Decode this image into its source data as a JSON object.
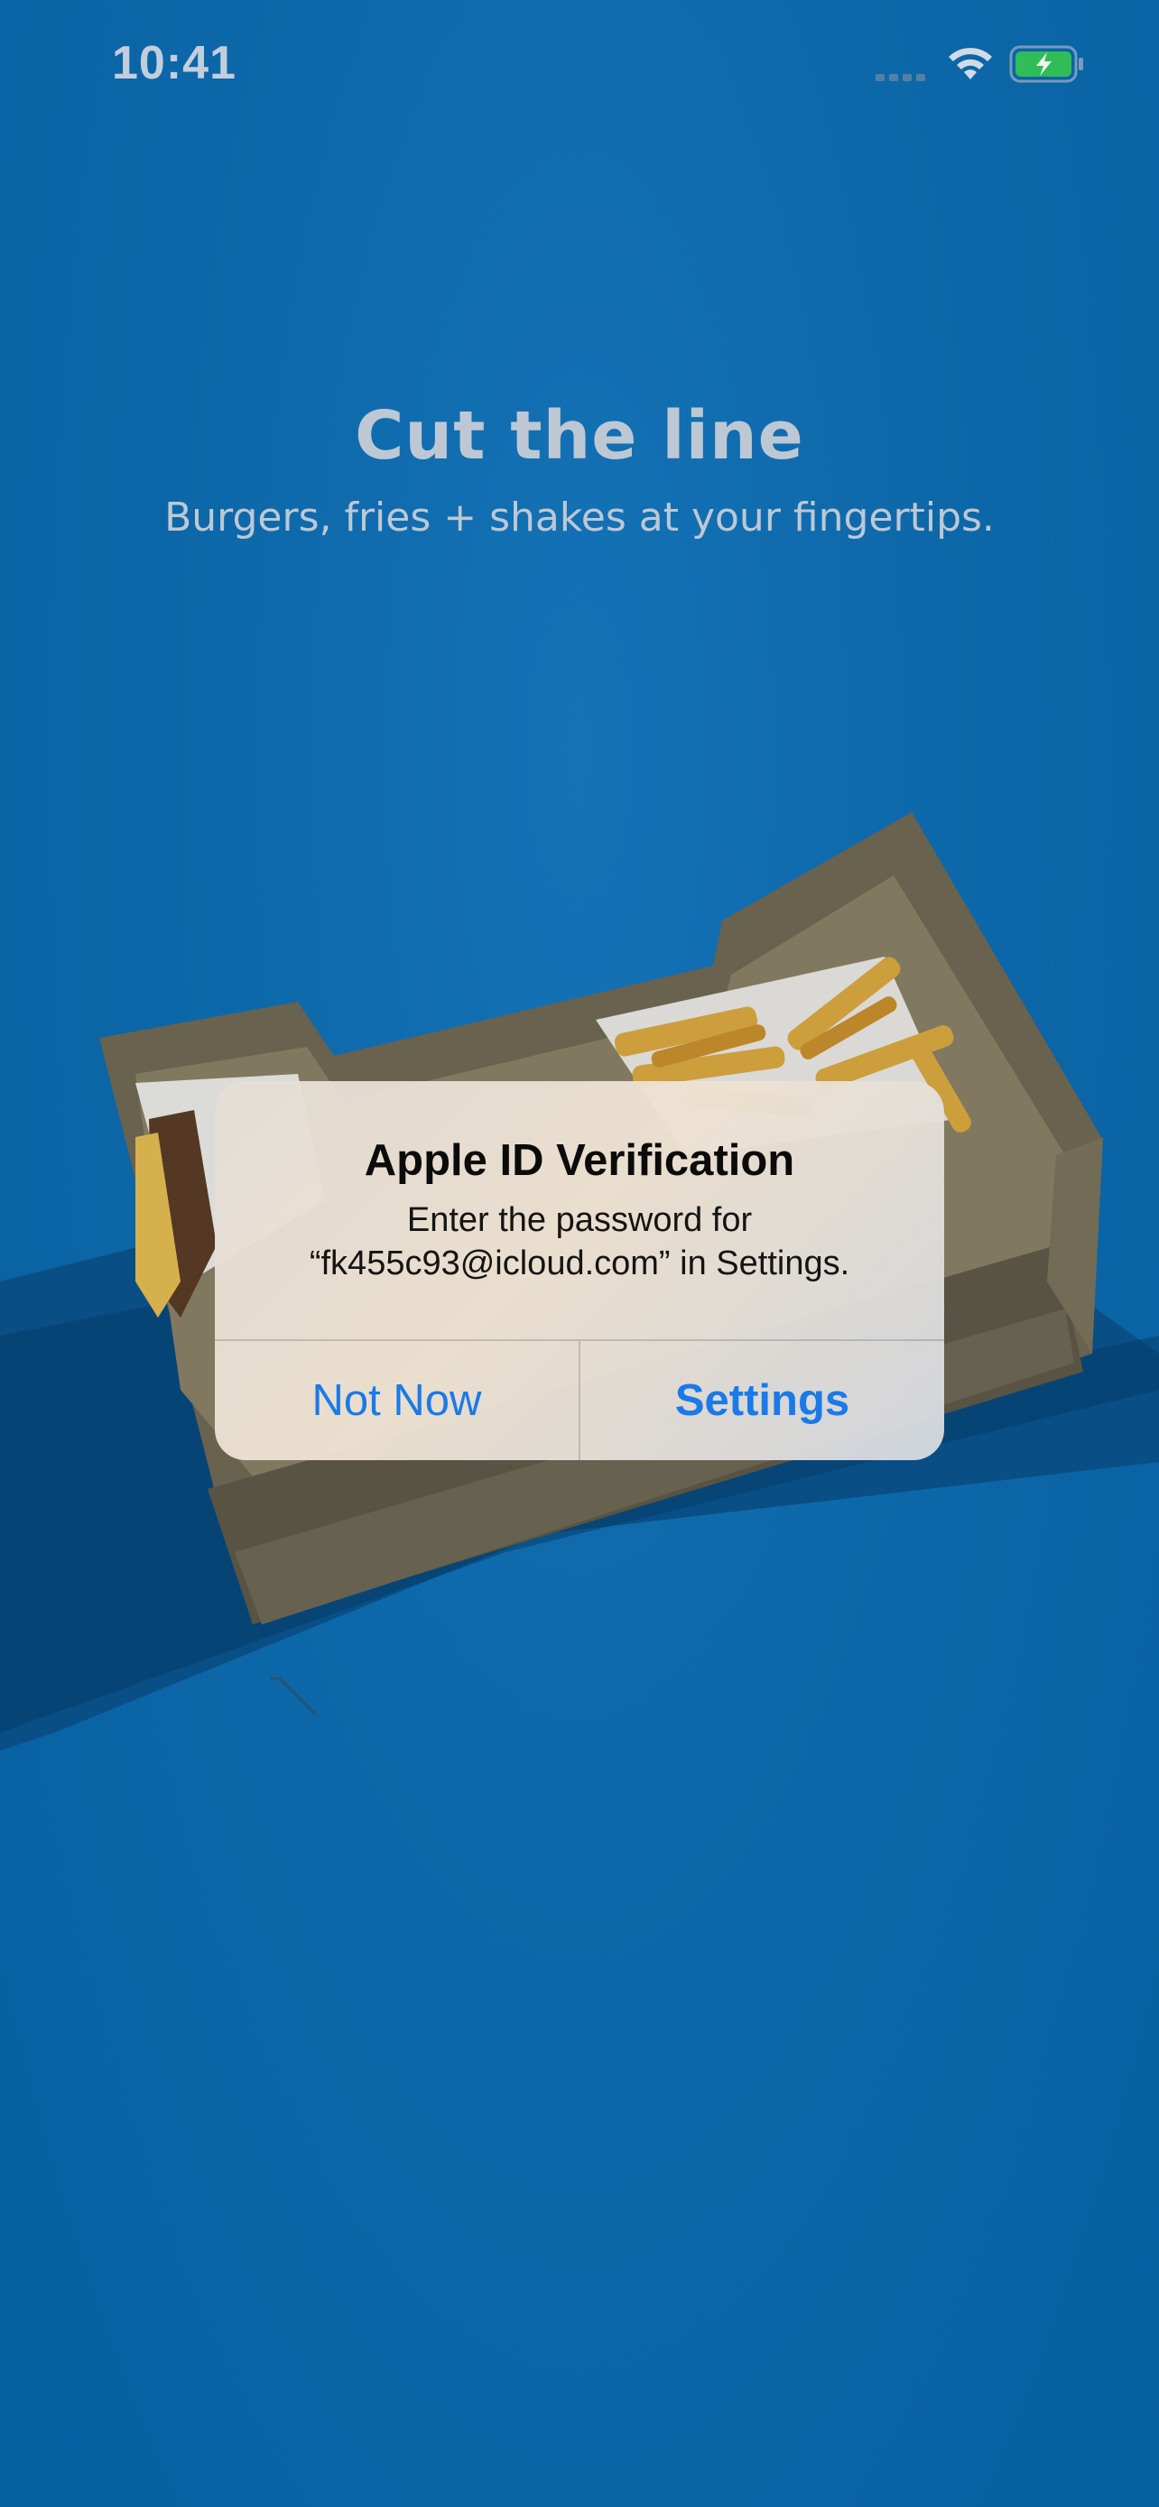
{
  "status_bar": {
    "time": "10:41",
    "icons": [
      "signal-icon",
      "wifi-icon",
      "battery-charging-icon"
    ]
  },
  "hero": {
    "title": "Cut the line",
    "subtitle": "Burgers, fries + shakes at your fingertips."
  },
  "background": {
    "image": "food-box-with-burger-and-fries",
    "color": "#0a6aab"
  },
  "alert": {
    "title": "Apple ID Verification",
    "message_line1": "Enter the password for",
    "message_line2": "“fk455c93@icloud.com” in Settings.",
    "buttons": {
      "cancel": "Not Now",
      "confirm": "Settings"
    },
    "button_color": "#1a7ae8"
  }
}
